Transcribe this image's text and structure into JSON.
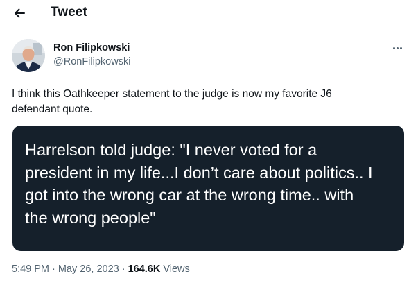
{
  "header": {
    "title": "Tweet"
  },
  "author": {
    "display_name": "Ron Filipkowski",
    "handle": "@RonFilipkowski"
  },
  "tweet": {
    "text_lines": [
      "I think this Oathkeeper statement to the judge is now my favorite J6",
      "defendant quote."
    ],
    "media_lines": [
      "Harrelson told judge: \"I never voted for a",
      "president in my life...I don’t care about politics.. I",
      "got into the wrong car at the wrong time.. with",
      "the wrong people\""
    ]
  },
  "meta": {
    "time": "5:49 PM",
    "separator": "·",
    "date": "May 26, 2023",
    "views_count": "164.6K",
    "views_label": "Views"
  },
  "colors": {
    "text_primary": "#0f1419",
    "text_secondary": "#536471",
    "media_background": "#15202b"
  },
  "icons": {
    "back": "arrow-left-icon",
    "more": "more-horizontal-icon"
  }
}
